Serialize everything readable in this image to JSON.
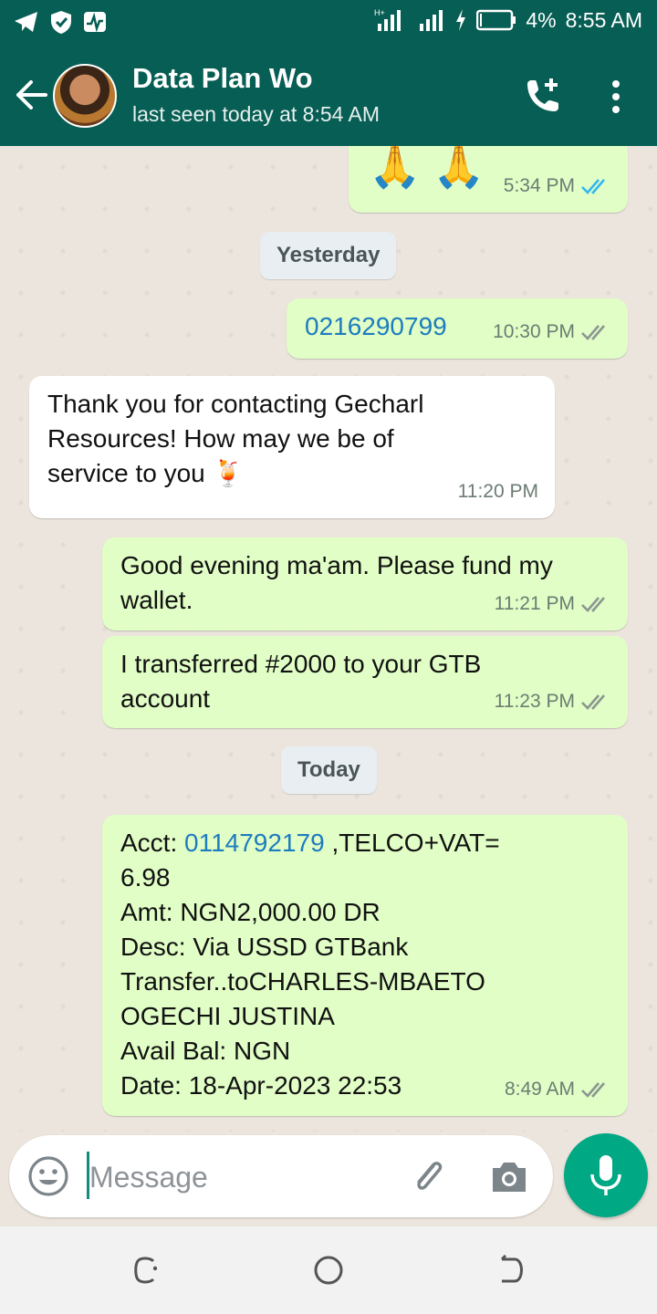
{
  "status_bar": {
    "battery": "4%",
    "time": "8:55 AM"
  },
  "header": {
    "contact_name": "Data Plan Wo",
    "last_seen": "last seen today at 8:54 AM"
  },
  "messages": [
    {
      "direction": "outgoing",
      "text": "🙏 🙏",
      "time": "5:34 PM",
      "status": "read"
    },
    {
      "type": "date",
      "text": "Yesterday"
    },
    {
      "direction": "outgoing",
      "text": "0216290799",
      "time": "10:30 PM",
      "status": "delivered"
    },
    {
      "direction": "incoming",
      "text": "Thank you for contacting Gecharl Resources! How may we be of service to you 🍹",
      "time": "11:20 PM"
    },
    {
      "direction": "outgoing",
      "text": "Good evening ma'am. Please fund my wallet.",
      "time": "11:21 PM",
      "status": "delivered"
    },
    {
      "direction": "outgoing",
      "text": "I transferred #2000 to your GTB account",
      "time": "11:23 PM",
      "status": "delivered"
    },
    {
      "type": "date",
      "text": "Today"
    },
    {
      "direction": "outgoing",
      "text": "Acct: 0114792179 ,TELCO+VAT= 6.98 Amt: NGN2,000.00 DR Desc: Via USSD GTBank Transfer..toCHARLES-MBAETO OGECHI JUSTINA Avail Bal: NGN Date: 18-Apr-2023 22:53",
      "time": "8:49 AM",
      "status": "delivered"
    }
  ],
  "receipt": {
    "acct_label": "Acct: ",
    "acct_number": "0114792179",
    "telco": " ,TELCO+VAT=",
    "lines": [
      "6.98",
      "Amt: NGN2,000.00 DR",
      "Desc: Via USSD GTBank",
      "Transfer..toCHARLES-MBAETO",
      "OGECHI JUSTINA",
      "Avail Bal: NGN",
      "Date: 18-Apr-2023 22:53"
    ]
  },
  "input": {
    "placeholder": "Message"
  },
  "colors": {
    "header": "#075e54",
    "outgoing_bubble": "#e1fec6",
    "incoming_bubble": "#ffffff",
    "read_ticks": "#34b7f1",
    "delivered_ticks": "#8a9690",
    "mic_button": "#00a884"
  },
  "icons": [
    "telegram-icon",
    "shield-icon",
    "activity-icon",
    "signal-icon",
    "battery-icon",
    "back-arrow-icon",
    "add-call-icon",
    "more-vert-icon",
    "emoji-icon",
    "paperclip-icon",
    "camera-icon",
    "mic-icon",
    "recents-icon",
    "home-icon",
    "back-icon"
  ]
}
